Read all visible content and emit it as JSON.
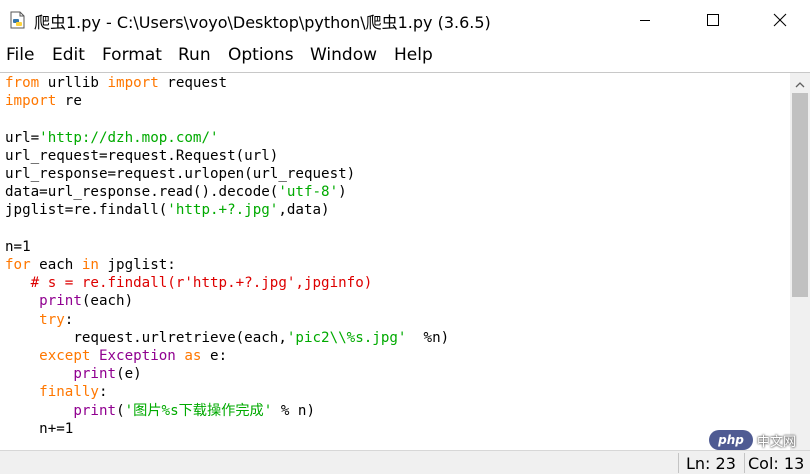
{
  "window": {
    "title": "爬虫1.py - C:\\Users\\voyo\\Desktop\\python\\爬虫1.py (3.6.5)",
    "icons": {
      "app": "python-file-icon",
      "minimize": "minimize-icon",
      "maximize": "maximize-icon",
      "close": "close-icon"
    }
  },
  "menu": {
    "file": "File",
    "edit": "Edit",
    "format": "Format",
    "run": "Run",
    "options": "Options",
    "window": "Window",
    "help": "Help"
  },
  "colors": {
    "keyword": "#ff7700",
    "string": "#00aa00",
    "comment": "#dd0000",
    "builtin": "#900090",
    "default": "#000000"
  },
  "code": [
    [
      {
        "t": "from",
        "c": "kw"
      },
      {
        "t": " urllib ",
        "c": "plain"
      },
      {
        "t": "import",
        "c": "kw"
      },
      {
        "t": " request",
        "c": "plain"
      }
    ],
    [
      {
        "t": "import",
        "c": "kw"
      },
      {
        "t": " re",
        "c": "plain"
      }
    ],
    [],
    [
      {
        "t": "url=",
        "c": "plain"
      },
      {
        "t": "'http://dzh.mop.com/'",
        "c": "str"
      }
    ],
    [
      {
        "t": "url_request=request.Request(url)",
        "c": "plain"
      }
    ],
    [
      {
        "t": "url_response=request.urlopen(url_request)",
        "c": "plain"
      }
    ],
    [
      {
        "t": "data=url_response.read().decode(",
        "c": "plain"
      },
      {
        "t": "'utf-8'",
        "c": "str"
      },
      {
        "t": ")",
        "c": "plain"
      }
    ],
    [
      {
        "t": "jpglist=re.findall(",
        "c": "plain"
      },
      {
        "t": "'http.+?.jpg'",
        "c": "str"
      },
      {
        "t": ",data)",
        "c": "plain"
      }
    ],
    [],
    [
      {
        "t": "n=1",
        "c": "plain"
      }
    ],
    [
      {
        "t": "for",
        "c": "kw"
      },
      {
        "t": " each ",
        "c": "plain"
      },
      {
        "t": "in",
        "c": "kw"
      },
      {
        "t": " jpglist:",
        "c": "plain"
      }
    ],
    [
      {
        "t": "   # s = re.findall(r'http.+?.jpg',jpginfo)",
        "c": "cmt"
      }
    ],
    [
      {
        "t": "    ",
        "c": "plain"
      },
      {
        "t": "print",
        "c": "bi"
      },
      {
        "t": "(each)",
        "c": "plain"
      }
    ],
    [
      {
        "t": "    ",
        "c": "plain"
      },
      {
        "t": "try",
        "c": "kw"
      },
      {
        "t": ":",
        "c": "plain"
      }
    ],
    [
      {
        "t": "        request.urlretrieve(each,",
        "c": "plain"
      },
      {
        "t": "'pic2\\\\%s.jpg'",
        "c": "str"
      },
      {
        "t": "  %n)",
        "c": "plain"
      }
    ],
    [
      {
        "t": "    ",
        "c": "plain"
      },
      {
        "t": "except",
        "c": "kw"
      },
      {
        "t": " ",
        "c": "plain"
      },
      {
        "t": "Exception",
        "c": "bi"
      },
      {
        "t": " ",
        "c": "plain"
      },
      {
        "t": "as",
        "c": "kw"
      },
      {
        "t": " e:",
        "c": "plain"
      }
    ],
    [
      {
        "t": "        ",
        "c": "plain"
      },
      {
        "t": "print",
        "c": "bi"
      },
      {
        "t": "(e)",
        "c": "plain"
      }
    ],
    [
      {
        "t": "    ",
        "c": "plain"
      },
      {
        "t": "finally",
        "c": "kw"
      },
      {
        "t": ":",
        "c": "plain"
      }
    ],
    [
      {
        "t": "        ",
        "c": "plain"
      },
      {
        "t": "print",
        "c": "bi"
      },
      {
        "t": "(",
        "c": "plain"
      },
      {
        "t": "'图片%s下载操作完成'",
        "c": "str"
      },
      {
        "t": " % n)",
        "c": "plain"
      }
    ],
    [
      {
        "t": "    n+=1",
        "c": "plain"
      }
    ]
  ],
  "status": {
    "line": "Ln: 23",
    "col": "Col: 13"
  },
  "watermark": {
    "logo": "php",
    "site": "中文网"
  }
}
